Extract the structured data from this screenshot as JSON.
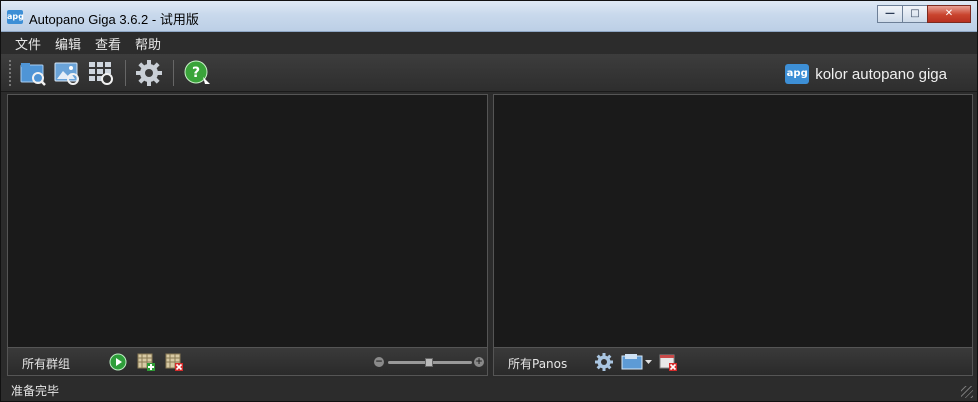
{
  "window": {
    "title": "Autopano Giga 3.6.2 - 试用版",
    "app_icon_text": "apg",
    "minimize_glyph": "—",
    "maximize_glyph": "□",
    "close_glyph": "✕"
  },
  "menu": {
    "items": [
      "文件",
      "编辑",
      "查看",
      "帮助"
    ]
  },
  "toolbar": {
    "brand_badge": "apg",
    "brand_text": "kolor autopano giga"
  },
  "left_panel": {
    "footer_label": "所有群组",
    "zoom_minus": "−",
    "zoom_plus": "+"
  },
  "right_panel": {
    "footer_label": "所有Panos"
  },
  "status": {
    "text": "准备完毕"
  },
  "colors": {
    "accent": "#3d8fd6",
    "panel_bg": "#1a1a1a",
    "toolbar_bg": "#333333"
  }
}
